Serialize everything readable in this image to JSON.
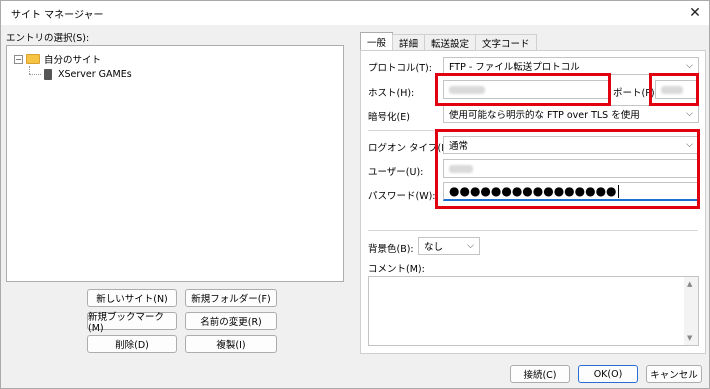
{
  "window": {
    "title": "サイト マネージャー",
    "close_glyph": "✕"
  },
  "tree": {
    "heading": "エントリの選択(S):",
    "root": {
      "expander": "−",
      "label": "自分のサイト"
    },
    "child": {
      "label": "XServer GAMEs"
    }
  },
  "left_buttons": {
    "new_site": "新しいサイト(N)",
    "new_folder": "新規フォルダー(F)",
    "new_bookmark": "新規ブックマーク(M)",
    "rename": "名前の変更(R)",
    "delete": "削除(D)",
    "duplicate": "複製(I)"
  },
  "tabs": [
    "一般",
    "詳細",
    "転送設定",
    "文字コード"
  ],
  "form": {
    "protocol": {
      "label": "プロトコル(T):",
      "value": "FTP - ファイル転送プロトコル"
    },
    "host": {
      "label": "ホスト(H):"
    },
    "port": {
      "label": "ポート(P):"
    },
    "encryption": {
      "label": "暗号化(E)",
      "value": "使用可能なら明示的な FTP over TLS を使用"
    },
    "logon_type": {
      "label": "ログオン タイプ(L):",
      "value": "通常"
    },
    "user": {
      "label": "ユーザー(U):"
    },
    "password": {
      "label": "パスワード(W):",
      "value": "●●●●●●●●●●●●●●●●"
    },
    "bg_color": {
      "label": "背景色(B):",
      "value": "なし"
    },
    "comment": {
      "label": "コメント(M):"
    }
  },
  "bottom_buttons": {
    "connect": "接続(C)",
    "ok": "OK(O)",
    "cancel": "キャンセル"
  },
  "colors": {
    "highlight_box": "#e0000f"
  },
  "icons": {
    "chevron": "chevron-down-icon",
    "folder": "folder-icon",
    "server": "server-icon",
    "close": "close-icon"
  }
}
